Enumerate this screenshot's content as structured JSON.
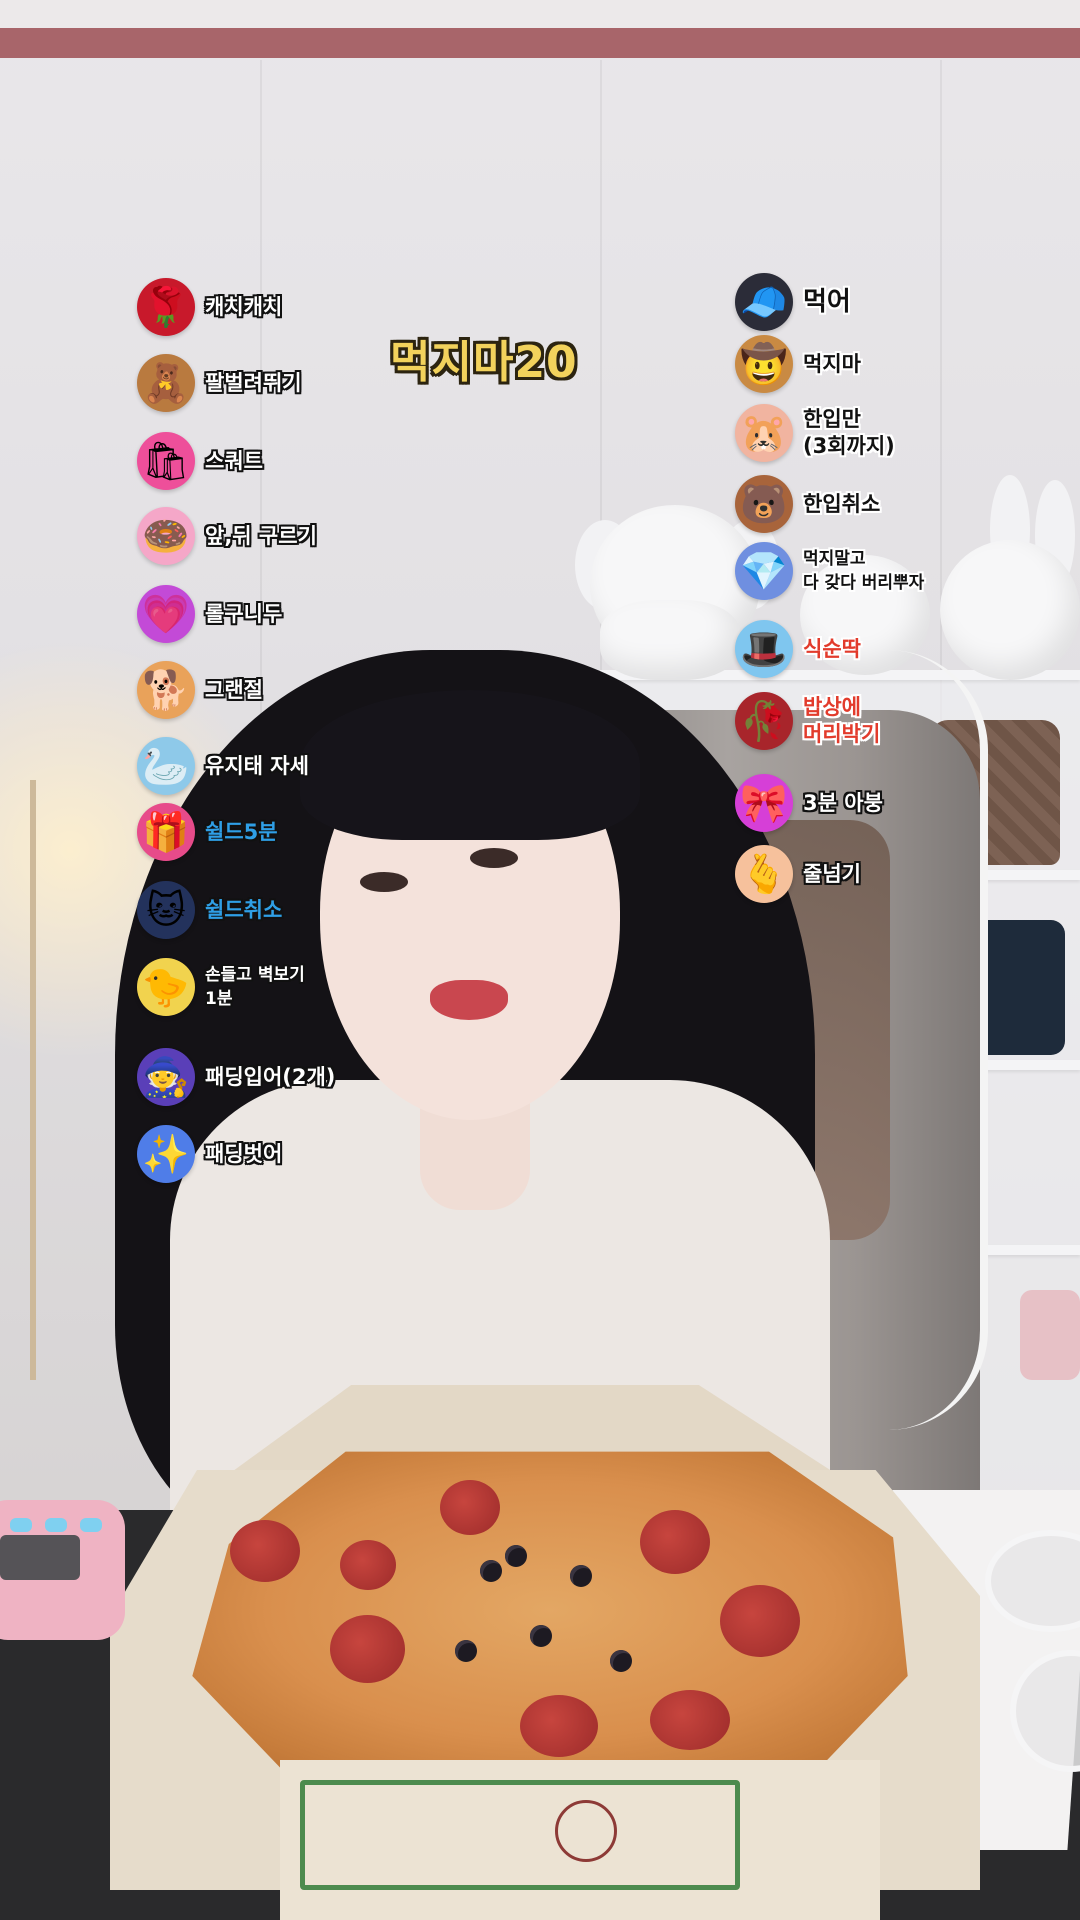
{
  "stream": {
    "counter_label": "먹지마20"
  },
  "left_menu": [
    {
      "icon": "rose-icon",
      "glyph": "🌹",
      "bg": "#c8192b",
      "label": "캐치캐치",
      "style": "white"
    },
    {
      "icon": "teddy-bears-icon",
      "glyph": "🧸",
      "bg": "#b97a3f",
      "label": "팔벌려뛰기",
      "style": "white"
    },
    {
      "icon": "gift-bag-icon",
      "glyph": "🛍",
      "bg": "#ee4f9a",
      "label": "스쿼트",
      "style": "white"
    },
    {
      "icon": "donut-icon",
      "glyph": "🍩",
      "bg": "#f5a7c8",
      "label": "앞,뒤 구르기",
      "style": "white"
    },
    {
      "icon": "heart-icon",
      "glyph": "💗",
      "bg": "#c34ad7",
      "label": "롤구니두",
      "style": "white"
    },
    {
      "icon": "corgi-icon",
      "glyph": "🐕",
      "bg": "#e9a25a",
      "label": "그랜절",
      "style": "white"
    },
    {
      "icon": "swan-icon",
      "glyph": "🦢",
      "bg": "#8ec9e9",
      "label": "유지태 자세",
      "style": "white"
    },
    {
      "icon": "tiktok-box-icon",
      "glyph": "🎁",
      "bg": "#e74b8a",
      "label": "쉴드5분",
      "style": "blue"
    },
    {
      "icon": "cat-glasses-icon",
      "glyph": "🐱",
      "bg": "#23325c",
      "label": "쉴드취소",
      "style": "blue"
    },
    {
      "icon": "chick-icon",
      "glyph": "🐤",
      "bg": "#f1d34e",
      "label": "손들고 벽보기\n1분",
      "style": "white",
      "size": "small"
    },
    {
      "icon": "wizard-icon",
      "glyph": "🧙",
      "bg": "#5a3fb8",
      "label": "패딩입어(2개)",
      "style": "white"
    },
    {
      "icon": "star-icon",
      "glyph": "✨",
      "bg": "#4f7de8",
      "label": "패딩벗어",
      "style": "white"
    }
  ],
  "right_menu": [
    {
      "icon": "cap-icon",
      "glyph": "🧢",
      "bg": "#2b2c38",
      "label": "먹어",
      "style": "dark",
      "size": "big"
    },
    {
      "icon": "cowboy-hat-icon",
      "glyph": "🤠",
      "bg": "#c98a43",
      "label": "먹지마",
      "style": "dark"
    },
    {
      "icon": "hamster-icon",
      "glyph": "🐹",
      "bg": "#f1b4a0",
      "label": "한입만\n(3회까지)",
      "style": "dark"
    },
    {
      "icon": "bear-icon",
      "glyph": "🐻",
      "bg": "#a8643b",
      "label": "한입취소",
      "style": "dark"
    },
    {
      "icon": "crystal-icon",
      "glyph": "💎",
      "bg": "#6f8fe0",
      "label": "먹지말고\n다 갖다 버리뿌자",
      "style": "dark",
      "size": "small"
    },
    {
      "icon": "magic-hat-icon",
      "glyph": "🎩",
      "bg": "#7fc6ef",
      "label": "식순딱",
      "style": "red"
    },
    {
      "icon": "rose-globe-icon",
      "glyph": "🥀",
      "bg": "#a8252b",
      "label": "밥상에\n머리박기",
      "style": "red"
    },
    {
      "icon": "bow-icon",
      "glyph": "🎀",
      "bg": "#d63fd7",
      "label": "3분 아붕",
      "style": "white-dark"
    },
    {
      "icon": "finger-heart-icon",
      "glyph": "🫰",
      "bg": "#f6c19c",
      "label": "줄넘기",
      "style": "white-dark"
    }
  ]
}
